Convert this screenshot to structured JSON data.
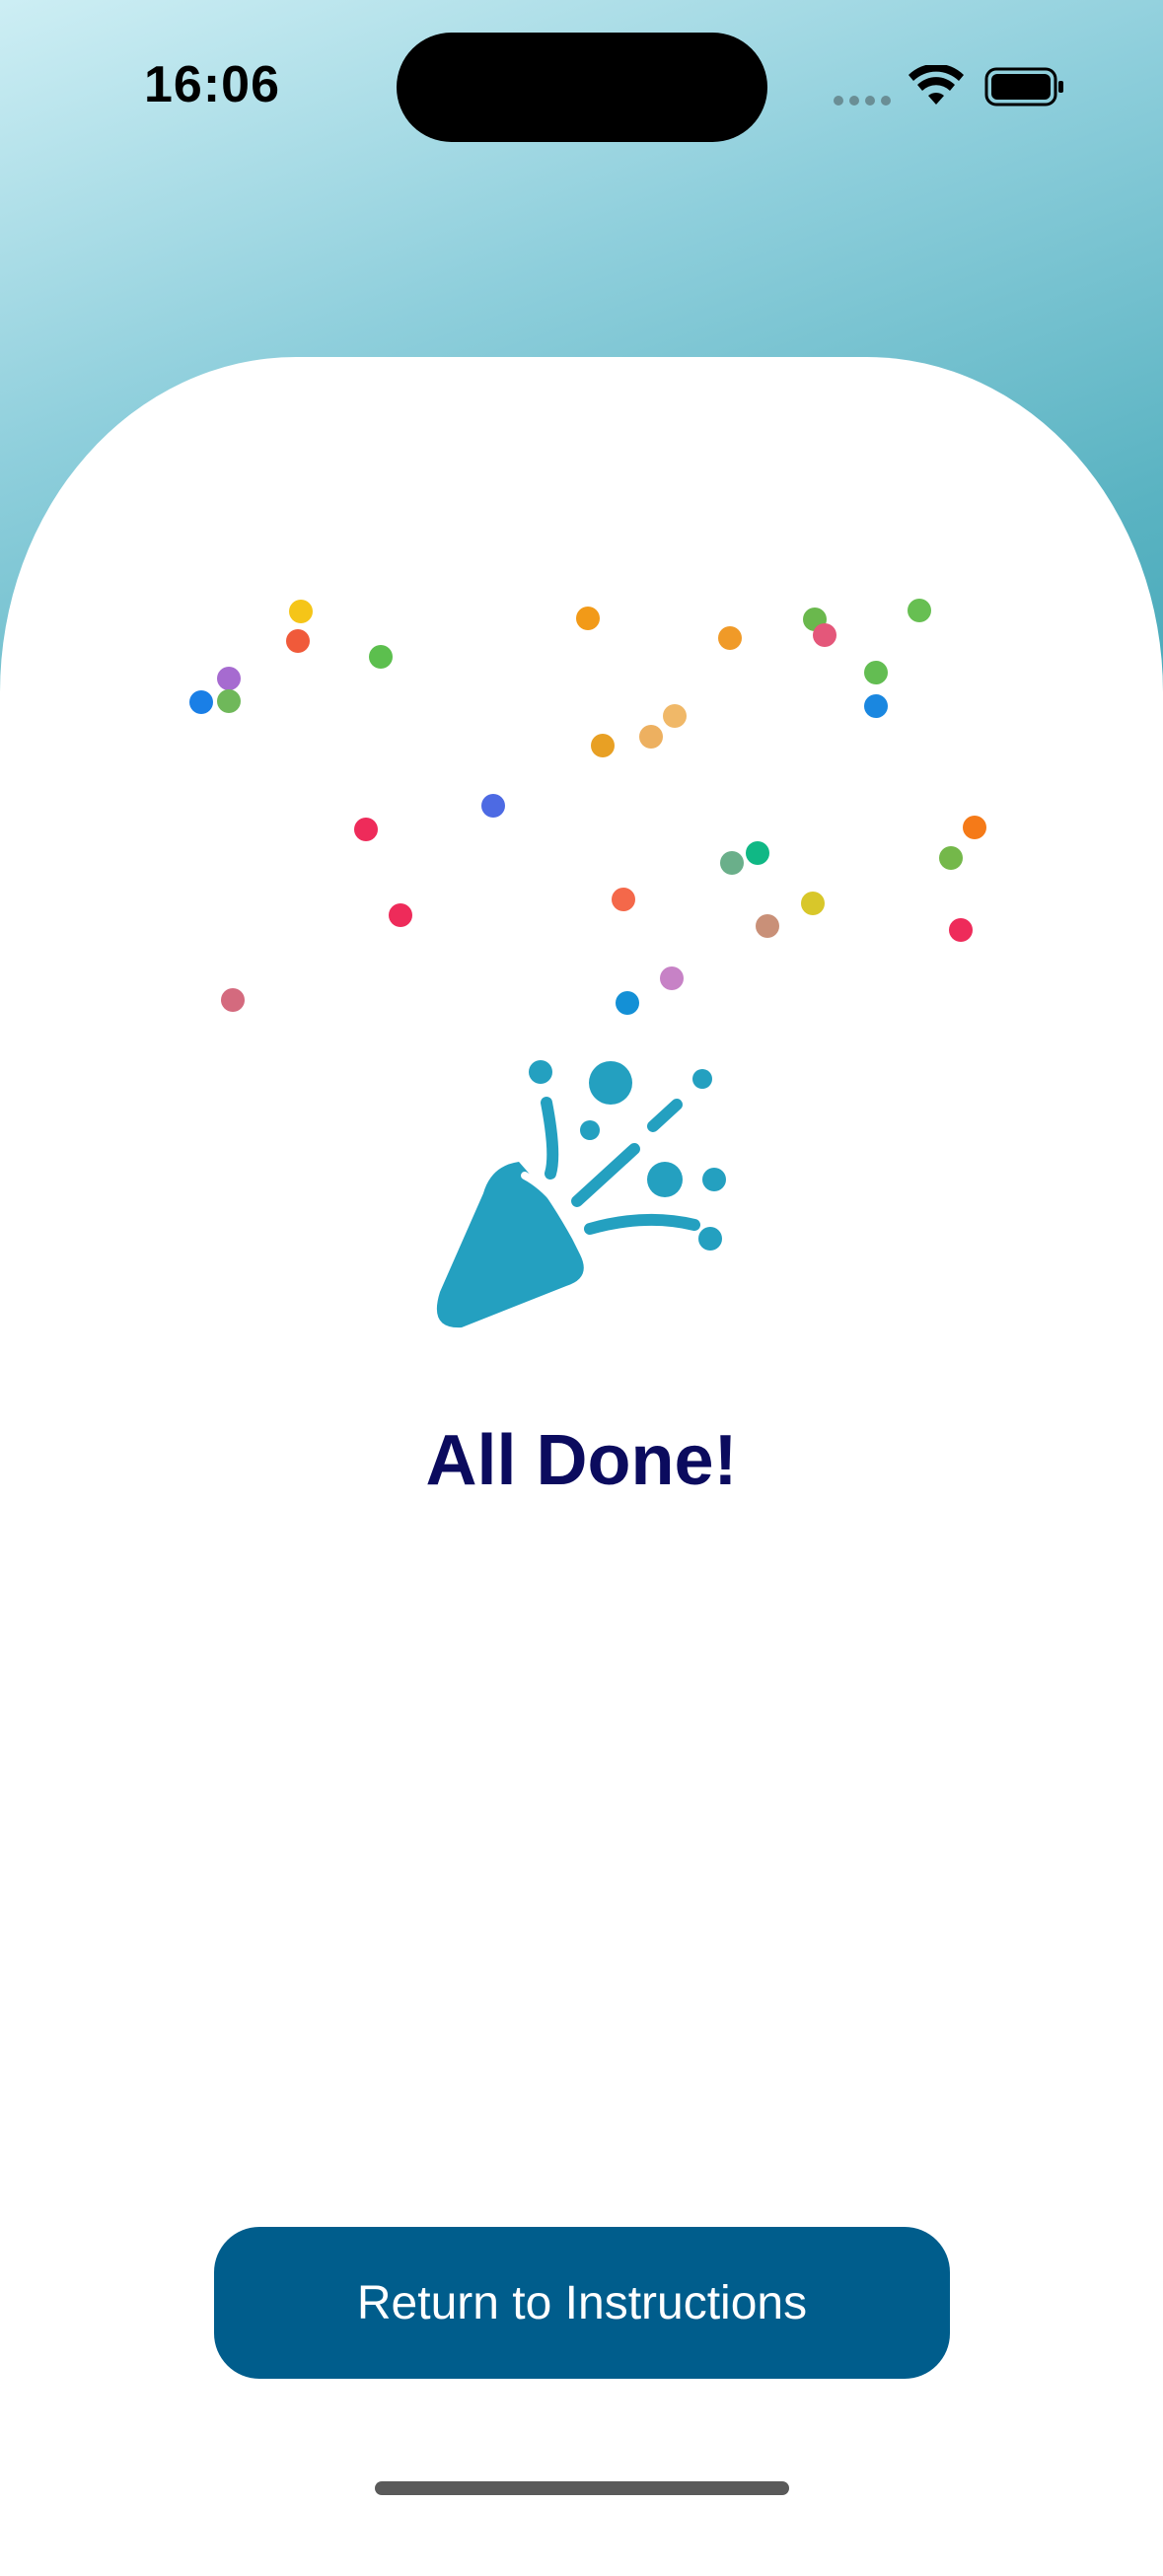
{
  "status_bar": {
    "time": "16:06",
    "icons": [
      "signal-dots-icon",
      "wifi-icon",
      "battery-icon"
    ]
  },
  "main": {
    "icon": "party-popper-icon",
    "icon_color": "#24a0c0",
    "title": "All Done!",
    "title_color": "#0b0b5e"
  },
  "actions": {
    "return_label": "Return to Instructions",
    "return_color": "#005d8c"
  }
}
